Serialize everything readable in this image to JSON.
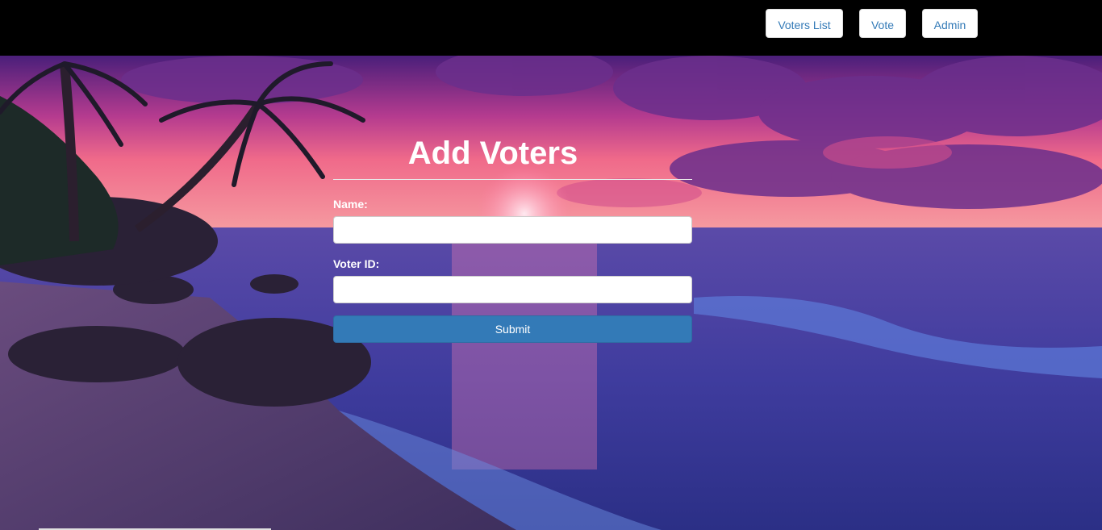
{
  "navbar": {
    "items": [
      {
        "label": "Voters List"
      },
      {
        "label": "Vote"
      },
      {
        "label": "Admin"
      }
    ]
  },
  "form": {
    "title": "Add Voters",
    "name_label": "Name:",
    "name_value": "",
    "voter_id_label": "Voter ID:",
    "voter_id_value": "",
    "submit_label": "Submit"
  },
  "colors": {
    "navbar_bg": "#000000",
    "button_primary": "#337ab7",
    "nav_link": "#337ab7"
  },
  "background": {
    "scene": "beach-sunset-image"
  }
}
